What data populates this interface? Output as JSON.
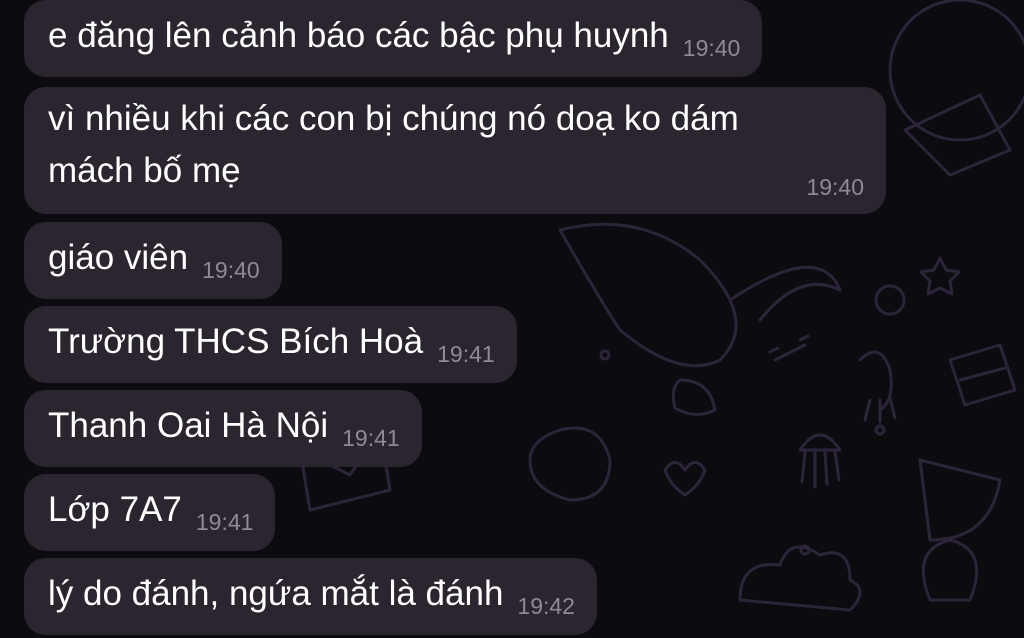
{
  "messages": [
    {
      "text": "e đăng lên cảnh báo các bậc phụ huynh",
      "time": "19:40"
    },
    {
      "text": "vì nhiều khi các con bị chúng nó doạ ko dám\nmách bố mẹ",
      "time": "19:40"
    },
    {
      "text": "giáo viên",
      "time": "19:40"
    },
    {
      "text": "Trường THCS Bích Hoà",
      "time": "19:41"
    },
    {
      "text": "Thanh Oai Hà Nội",
      "time": "19:41"
    },
    {
      "text": "Lớp 7A7",
      "time": "19:41"
    },
    {
      "text": "lý do đánh, ngứa mắt là đánh",
      "time": "19:42"
    }
  ]
}
